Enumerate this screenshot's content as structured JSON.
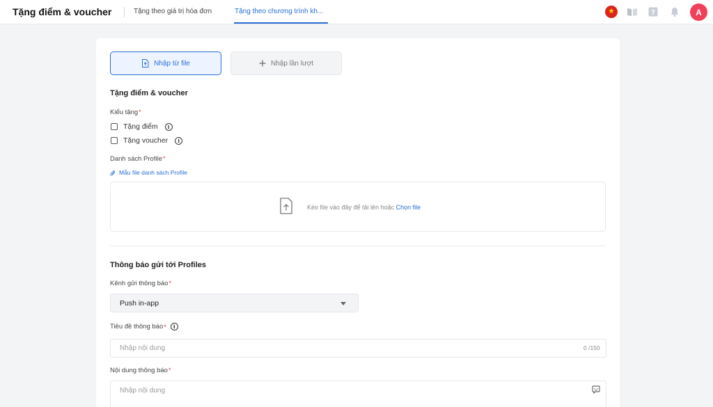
{
  "header": {
    "title": "Tặng điểm & voucher",
    "tabs": [
      {
        "label": "Tặng theo giá trị hóa đơn"
      },
      {
        "label": "Tặng theo chương trình kh..."
      }
    ],
    "avatar_initial": "A",
    "icons": [
      "vietnam-flag-icon",
      "book-icon",
      "help-icon",
      "bell-icon"
    ]
  },
  "import_buttons": {
    "from_file": "Nhập từ file",
    "manual": "Nhập lần lượt"
  },
  "gift_section": {
    "title": "Tặng điểm & voucher",
    "type_label": "Kiểu tặng",
    "options": [
      {
        "label": "Tặng điểm"
      },
      {
        "label": "Tặng voucher"
      }
    ],
    "profile_list_label": "Danh sách Profile",
    "template_link": "Mẫu file danh sách Profile",
    "dropzone_text": "Kéo file vào đây để tải lên hoặc",
    "dropzone_link": "Chọn file"
  },
  "notify_section": {
    "title": "Thông báo gửi tới Profiles",
    "channel_label": "Kênh gửi thông báo",
    "channel_value": "Push in-app",
    "title_label": "Tiêu đề thông báo",
    "title_placeholder": "Nhập nội dung",
    "title_counter": "0 /150",
    "content_label": "Nội dung thông báo",
    "content_placeholder": "Nhập nội dung"
  },
  "colors": {
    "accent": "#2a6fd6",
    "required": "#e53935",
    "avatar": "#f0405a"
  }
}
